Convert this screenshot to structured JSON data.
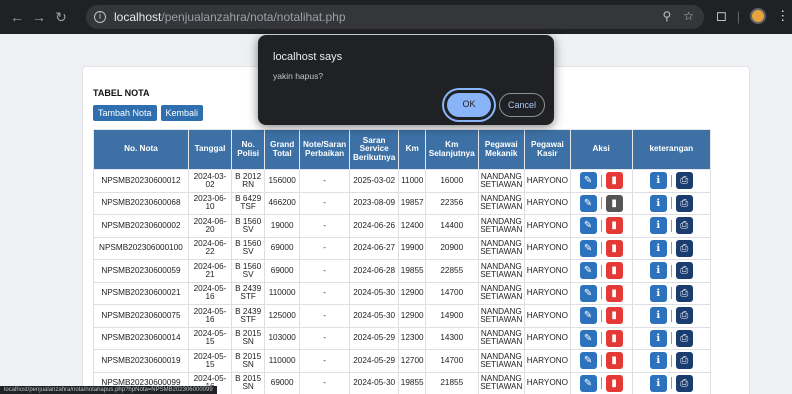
{
  "browser": {
    "url_host": "localhost",
    "url_path": "/penjualanzahra/nota/notalihat.php",
    "status_url": "localhost/penjualanzahra/nota/notahapus.php?hpNota=NPSMB202306000099"
  },
  "page": {
    "title": "TABEL NOTA",
    "add_label": "Tambah Nota",
    "back_label": "Kembali"
  },
  "table": {
    "headers": [
      "No. Nota",
      "Tanggal",
      "No. Polisi",
      "Grand Total",
      "Note/Saran Perbaikan",
      "Saran Service Berikutnya",
      "Km",
      "Km Selanjutnya",
      "Pegawai Mekanik",
      "Pegawai Kasir",
      "Aksi",
      "keterangan"
    ],
    "rows": [
      {
        "nota": "NPSMB20230600012",
        "tanggal": "2024-03-02",
        "polisi": "B 2012 RN",
        "total": "156000",
        "note": "-",
        "saran": "2025-03-02",
        "km": "11000",
        "km_next": "16000",
        "mekanik": "NANDANG SETIAWAN",
        "kasir": "HARYONO"
      },
      {
        "nota": "NPSMB20230600068",
        "tanggal": "2023-06-10",
        "polisi": "B 6429 TSF",
        "total": "466200",
        "note": "-",
        "saran": "2023-08-09",
        "km": "19857",
        "km_next": "22356",
        "mekanik": "NANDANG SETIAWAN",
        "kasir": "HARYONO"
      },
      {
        "nota": "NPSMB20230600002",
        "tanggal": "2024-06-20",
        "polisi": "B 1560 SV",
        "total": "19000",
        "note": "-",
        "saran": "2024-06-26",
        "km": "12400",
        "km_next": "14400",
        "mekanik": "NANDANG SETIAWAN",
        "kasir": "HARYONO"
      },
      {
        "nota": "NPSMB202306000100",
        "tanggal": "2024-06-22",
        "polisi": "B 1560 SV",
        "total": "69000",
        "note": "-",
        "saran": "2024-06-27",
        "km": "19900",
        "km_next": "20900",
        "mekanik": "NANDANG SETIAWAN",
        "kasir": "HARYONO"
      },
      {
        "nota": "NPSMB20230600059",
        "tanggal": "2024-06-21",
        "polisi": "B 1560 SV",
        "total": "69000",
        "note": "-",
        "saran": "2024-06-28",
        "km": "19855",
        "km_next": "22855",
        "mekanik": "NANDANG SETIAWAN",
        "kasir": "HARYONO"
      },
      {
        "nota": "NPSMB20230600021",
        "tanggal": "2024-05-16",
        "polisi": "B 2439 STF",
        "total": "110000",
        "note": "-",
        "saran": "2024-05-30",
        "km": "12900",
        "km_next": "14700",
        "mekanik": "NANDANG SETIAWAN",
        "kasir": "HARYONO"
      },
      {
        "nota": "NPSMB20230600075",
        "tanggal": "2024-05-16",
        "polisi": "B 2439 STF",
        "total": "125000",
        "note": "-",
        "saran": "2024-05-30",
        "km": "12900",
        "km_next": "14900",
        "mekanik": "NANDANG SETIAWAN",
        "kasir": "HARYONO"
      },
      {
        "nota": "NPSMB20230600014",
        "tanggal": "2024-05-15",
        "polisi": "B 2015 SN",
        "total": "103000",
        "note": "-",
        "saran": "2024-05-29",
        "km": "12300",
        "km_next": "14300",
        "mekanik": "NANDANG SETIAWAN",
        "kasir": "HARYONO"
      },
      {
        "nota": "NPSMB20230600019",
        "tanggal": "2024-05-15",
        "polisi": "B 2015 SN",
        "total": "110000",
        "note": "-",
        "saran": "2024-05-29",
        "km": "12700",
        "km_next": "14700",
        "mekanik": "NANDANG SETIAWAN",
        "kasir": "HARYONO"
      },
      {
        "nota": "NPSMB20230600099",
        "tanggal": "2024-05-16",
        "polisi": "B 2015 SN",
        "total": "69000",
        "note": "-",
        "saran": "2024-05-30",
        "km": "19855",
        "km_next": "21855",
        "mekanik": "NANDANG SETIAWAN",
        "kasir": "HARYONO"
      }
    ]
  },
  "dialog": {
    "title": "localhost says",
    "message": "yakin hapus?",
    "ok_label": "OK",
    "cancel_label": "Cancel"
  },
  "icons": {
    "back": "back-arrow-icon",
    "forward": "forward-arrow-icon",
    "reload": "reload-icon",
    "edit": "pencil-icon",
    "delete": "trash-icon",
    "info": "info-icon",
    "print": "print-icon"
  },
  "colors": {
    "header": "#3d71a6",
    "edit": "#2c72bd",
    "delete": "#e53935",
    "print": "#1a3c6e",
    "dialog_accent": "#8ab4f8"
  }
}
